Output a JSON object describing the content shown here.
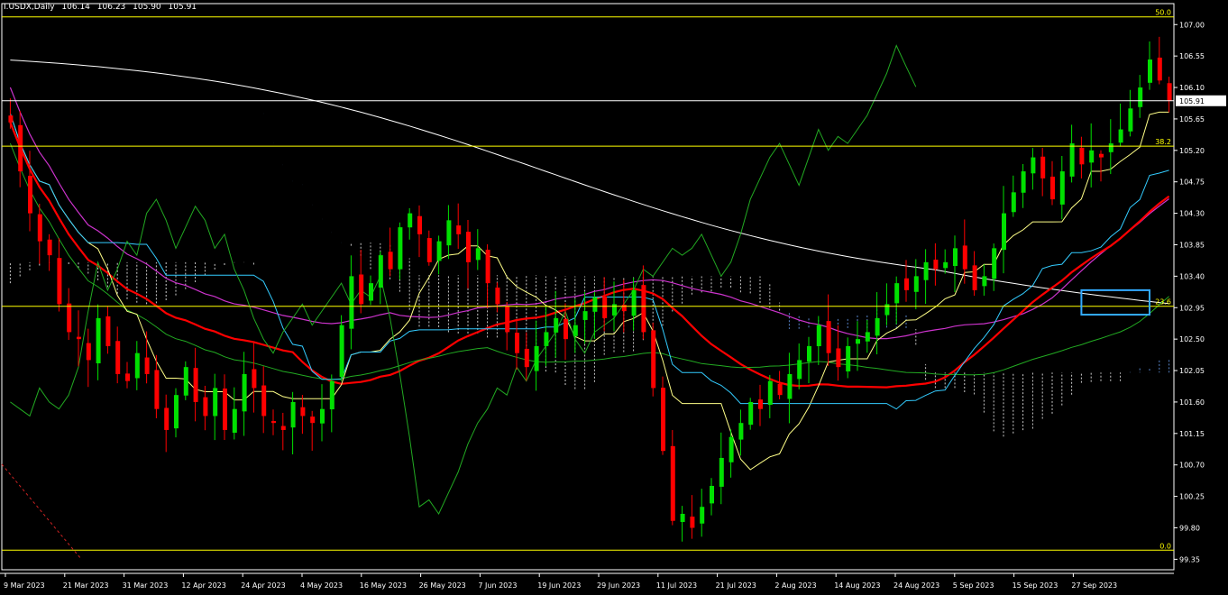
{
  "header": {
    "symbol": "I.USDX,Daily",
    "open": "106.14",
    "high": "106.23",
    "low": "105.90",
    "close": "105.91"
  },
  "colors": {
    "background": "#000000",
    "bull": "#00e000",
    "bear": "#ff0000",
    "fib": "#ffff00",
    "ema200": "#ffffff",
    "ma_red": "#ff0000",
    "ma_magenta": "#cc33cc",
    "ma_green": "#22aa22",
    "tenkan": "#ffff88",
    "kijun": "#33ccff",
    "chikou": "#22aa22",
    "cloud": "#6fa8ff",
    "highlight_box": "#33aaff"
  },
  "chart_data": {
    "type": "candlestick",
    "current_price": 105.91,
    "ylim": [
      99.2,
      107.3
    ],
    "y_ticks": [
      99.35,
      99.8,
      100.25,
      100.7,
      101.15,
      101.6,
      102.05,
      102.5,
      102.95,
      103.4,
      103.85,
      104.3,
      104.75,
      105.2,
      105.65,
      106.1,
      106.55,
      107.0
    ],
    "x_labels": [
      "9 Mar 2023",
      "21 Mar 2023",
      "31 Mar 2023",
      "12 Apr 2023",
      "24 Apr 2023",
      "4 May 2023",
      "16 May 2023",
      "26 May 2023",
      "7 Jun 2023",
      "19 Jun 2023",
      "29 Jun 2023",
      "11 Jul 2023",
      "21 Jul 2023",
      "2 Aug 2023",
      "14 Aug 2023",
      "24 Aug 2023",
      "5 Sep 2023",
      "15 Sep 2023",
      "27 Sep 2023"
    ],
    "fib_levels": [
      {
        "label": "50.0",
        "value": 107.11
      },
      {
        "label": "38.2",
        "value": 105.26
      },
      {
        "label": "23.6",
        "value": 102.97
      },
      {
        "label": "0.0",
        "value": 99.48
      }
    ],
    "close_path": [
      105.6,
      104.9,
      104.3,
      103.9,
      103.7,
      103.0,
      102.6,
      102.5,
      102.2,
      102.8,
      102.4,
      102.0,
      101.9,
      102.3,
      102.0,
      101.5,
      101.2,
      101.7,
      102.1,
      101.6,
      101.4,
      101.8,
      101.2,
      101.5,
      102.0,
      101.8,
      101.4,
      101.3,
      101.2,
      101.6,
      101.4,
      101.3,
      101.5,
      101.9,
      102.7,
      103.4,
      103.0,
      103.3,
      103.7,
      103.5,
      104.1,
      104.3,
      104.0,
      103.6,
      103.9,
      104.2,
      104.0,
      103.6,
      103.8,
      103.3,
      103.0,
      102.6,
      102.3,
      102.1,
      102.4,
      102.6,
      102.8,
      102.5,
      102.7,
      102.9,
      103.1,
      102.8,
      103.0,
      102.9,
      103.2,
      102.6,
      101.8,
      100.9,
      99.9,
      100.0,
      99.8,
      100.1,
      100.4,
      100.8,
      101.1,
      101.3,
      101.6,
      101.5,
      101.9,
      101.7,
      102.0,
      102.2,
      102.4,
      102.7,
      102.3,
      102.1,
      102.4,
      102.5,
      102.6,
      102.8,
      103.0,
      103.3,
      103.2,
      103.4,
      103.6,
      103.5,
      103.6,
      103.8,
      103.5,
      103.2,
      103.4,
      103.8,
      104.3,
      104.6,
      104.9,
      105.1,
      104.8,
      104.5,
      104.9,
      105.3,
      105.0,
      105.2,
      105.1,
      105.3,
      105.5,
      105.8,
      106.1,
      106.5,
      106.2,
      105.91
    ],
    "highlight_box": {
      "x_from": "15 Sep 2023",
      "x_to": "25 Sep 2023",
      "y_from": 102.85,
      "y_to": 103.2
    }
  }
}
